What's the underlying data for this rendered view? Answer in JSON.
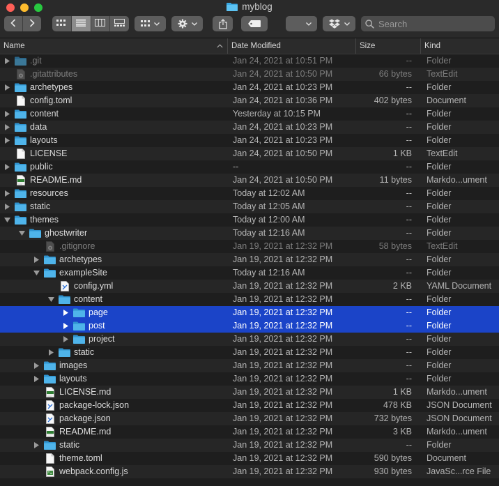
{
  "window": {
    "title": "myblog"
  },
  "toolbar": {
    "search_placeholder": "Search"
  },
  "columns": {
    "name": "Name",
    "date": "Date Modified",
    "size": "Size",
    "kind": "Kind"
  },
  "colors": {
    "selection": "#1b44c8",
    "folder": "#3aa9e4",
    "accent_red": "#fe5f57",
    "accent_yellow": "#febc2e",
    "accent_green": "#28c840"
  },
  "rows": [
    {
      "name": ".git",
      "date": "Jan 24, 2021 at 10:51 PM",
      "size": "--",
      "kind": "Folder",
      "depth": 0,
      "expander": "collapsed",
      "icon": "folder-icon",
      "dim": true,
      "selected": false
    },
    {
      "name": ".gitattributes",
      "date": "Jan 24, 2021 at 10:50 PM",
      "size": "66 bytes",
      "kind": "TextEdit",
      "depth": 0,
      "expander": "none",
      "icon": "gear-doc-icon",
      "dim": true,
      "selected": false
    },
    {
      "name": "archetypes",
      "date": "Jan 24, 2021 at 10:23 PM",
      "size": "--",
      "kind": "Folder",
      "depth": 0,
      "expander": "collapsed",
      "icon": "folder-icon",
      "dim": false,
      "selected": false
    },
    {
      "name": "config.toml",
      "date": "Jan 24, 2021 at 10:36 PM",
      "size": "402 bytes",
      "kind": "Document",
      "depth": 0,
      "expander": "none",
      "icon": "document-icon",
      "dim": false,
      "selected": false
    },
    {
      "name": "content",
      "date": "Yesterday at 10:15 PM",
      "size": "--",
      "kind": "Folder",
      "depth": 0,
      "expander": "collapsed",
      "icon": "folder-icon",
      "dim": false,
      "selected": false
    },
    {
      "name": "data",
      "date": "Jan 24, 2021 at 10:23 PM",
      "size": "--",
      "kind": "Folder",
      "depth": 0,
      "expander": "collapsed",
      "icon": "folder-icon",
      "dim": false,
      "selected": false
    },
    {
      "name": "layouts",
      "date": "Jan 24, 2021 at 10:23 PM",
      "size": "--",
      "kind": "Folder",
      "depth": 0,
      "expander": "collapsed",
      "icon": "folder-icon",
      "dim": false,
      "selected": false
    },
    {
      "name": "LICENSE",
      "date": "Jan 24, 2021 at 10:50 PM",
      "size": "1 KB",
      "kind": "TextEdit",
      "depth": 0,
      "expander": "none",
      "icon": "document-icon",
      "dim": false,
      "selected": false
    },
    {
      "name": "public",
      "date": "--",
      "size": "--",
      "kind": "Folder",
      "depth": 0,
      "expander": "collapsed",
      "icon": "folder-icon",
      "dim": false,
      "selected": false
    },
    {
      "name": "README.md",
      "date": "Jan 24, 2021 at 10:50 PM",
      "size": "11 bytes",
      "kind": "Markdo...ument",
      "depth": 0,
      "expander": "none",
      "icon": "text-doc-icon",
      "dim": false,
      "selected": false
    },
    {
      "name": "resources",
      "date": "Today at 12:02 AM",
      "size": "--",
      "kind": "Folder",
      "depth": 0,
      "expander": "collapsed",
      "icon": "folder-icon",
      "dim": false,
      "selected": false
    },
    {
      "name": "static",
      "date": "Today at 12:05 AM",
      "size": "--",
      "kind": "Folder",
      "depth": 0,
      "expander": "collapsed",
      "icon": "folder-icon",
      "dim": false,
      "selected": false
    },
    {
      "name": "themes",
      "date": "Today at 12:00 AM",
      "size": "--",
      "kind": "Folder",
      "depth": 0,
      "expander": "expanded",
      "icon": "folder-icon",
      "dim": false,
      "selected": false
    },
    {
      "name": "ghostwriter",
      "date": "Today at 12:16 AM",
      "size": "--",
      "kind": "Folder",
      "depth": 1,
      "expander": "expanded",
      "icon": "folder-icon",
      "dim": false,
      "selected": false
    },
    {
      "name": ".gitignore",
      "date": "Jan 19, 2021 at 12:32 PM",
      "size": "58 bytes",
      "kind": "TextEdit",
      "depth": 2,
      "expander": "none",
      "icon": "gear-doc-icon",
      "dim": true,
      "selected": false
    },
    {
      "name": "archetypes",
      "date": "Jan 19, 2021 at 12:32 PM",
      "size": "--",
      "kind": "Folder",
      "depth": 2,
      "expander": "collapsed",
      "icon": "folder-icon",
      "dim": false,
      "selected": false
    },
    {
      "name": "exampleSite",
      "date": "Today at 12:16 AM",
      "size": "--",
      "kind": "Folder",
      "depth": 2,
      "expander": "expanded",
      "icon": "folder-icon",
      "dim": false,
      "selected": false
    },
    {
      "name": "config.yml",
      "date": "Jan 19, 2021 at 12:32 PM",
      "size": "2 KB",
      "kind": "YAML Document",
      "depth": 3,
      "expander": "none",
      "icon": "code-doc-icon",
      "dim": false,
      "selected": false
    },
    {
      "name": "content",
      "date": "Jan 19, 2021 at 12:32 PM",
      "size": "--",
      "kind": "Folder",
      "depth": 3,
      "expander": "expanded",
      "icon": "folder-icon",
      "dim": false,
      "selected": false
    },
    {
      "name": "page",
      "date": "Jan 19, 2021 at 12:32 PM",
      "size": "--",
      "kind": "Folder",
      "depth": 4,
      "expander": "collapsed",
      "icon": "folder-icon",
      "dim": false,
      "selected": true
    },
    {
      "name": "post",
      "date": "Jan 19, 2021 at 12:32 PM",
      "size": "--",
      "kind": "Folder",
      "depth": 4,
      "expander": "collapsed",
      "icon": "folder-icon",
      "dim": false,
      "selected": true
    },
    {
      "name": "project",
      "date": "Jan 19, 2021 at 12:32 PM",
      "size": "--",
      "kind": "Folder",
      "depth": 4,
      "expander": "collapsed",
      "icon": "folder-icon",
      "dim": false,
      "selected": false
    },
    {
      "name": "static",
      "date": "Jan 19, 2021 at 12:32 PM",
      "size": "--",
      "kind": "Folder",
      "depth": 3,
      "expander": "collapsed",
      "icon": "folder-icon",
      "dim": false,
      "selected": false
    },
    {
      "name": "images",
      "date": "Jan 19, 2021 at 12:32 PM",
      "size": "--",
      "kind": "Folder",
      "depth": 2,
      "expander": "collapsed",
      "icon": "folder-icon",
      "dim": false,
      "selected": false
    },
    {
      "name": "layouts",
      "date": "Jan 19, 2021 at 12:32 PM",
      "size": "--",
      "kind": "Folder",
      "depth": 2,
      "expander": "collapsed",
      "icon": "folder-icon",
      "dim": false,
      "selected": false
    },
    {
      "name": "LICENSE.md",
      "date": "Jan 19, 2021 at 12:32 PM",
      "size": "1 KB",
      "kind": "Markdo...ument",
      "depth": 2,
      "expander": "none",
      "icon": "text-doc-icon",
      "dim": false,
      "selected": false
    },
    {
      "name": "package-lock.json",
      "date": "Jan 19, 2021 at 12:32 PM",
      "size": "478 KB",
      "kind": "JSON Document",
      "depth": 2,
      "expander": "none",
      "icon": "code-doc-icon",
      "dim": false,
      "selected": false
    },
    {
      "name": "package.json",
      "date": "Jan 19, 2021 at 12:32 PM",
      "size": "732 bytes",
      "kind": "JSON Document",
      "depth": 2,
      "expander": "none",
      "icon": "code-doc-icon",
      "dim": false,
      "selected": false
    },
    {
      "name": "README.md",
      "date": "Jan 19, 2021 at 12:32 PM",
      "size": "3 KB",
      "kind": "Markdo...ument",
      "depth": 2,
      "expander": "none",
      "icon": "text-doc-icon",
      "dim": false,
      "selected": false
    },
    {
      "name": "static",
      "date": "Jan 19, 2021 at 12:32 PM",
      "size": "--",
      "kind": "Folder",
      "depth": 2,
      "expander": "collapsed",
      "icon": "folder-icon",
      "dim": false,
      "selected": false
    },
    {
      "name": "theme.toml",
      "date": "Jan 19, 2021 at 12:32 PM",
      "size": "590 bytes",
      "kind": "Document",
      "depth": 2,
      "expander": "none",
      "icon": "document-icon",
      "dim": false,
      "selected": false
    },
    {
      "name": "webpack.config.js",
      "date": "Jan 19, 2021 at 12:32 PM",
      "size": "930 bytes",
      "kind": "JavaSc...rce File",
      "depth": 2,
      "expander": "none",
      "icon": "js-doc-icon",
      "dim": false,
      "selected": false
    }
  ]
}
